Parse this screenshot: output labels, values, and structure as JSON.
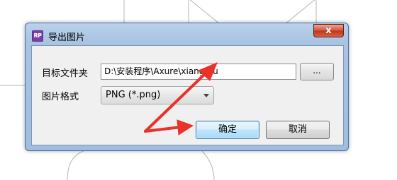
{
  "dialog": {
    "title": "导出图片",
    "app_icon_text": "RP",
    "close_symbol": "x",
    "folder_label": "目标文件夹",
    "folder_value": "D:\\安装程序\\Axure\\xiangmu",
    "browse_label": "...",
    "format_label": "图片格式",
    "format_value": "PNG (*.png)",
    "ok_label": "确定",
    "cancel_label": "取消"
  },
  "colors": {
    "annotation_arrow": "#e8322a",
    "frame": "#a9c4e2",
    "close_button": "#c7391f"
  },
  "icons": {
    "close": "close-icon",
    "dropdown": "chevron-down-icon",
    "app": "axure-rp-icon"
  }
}
